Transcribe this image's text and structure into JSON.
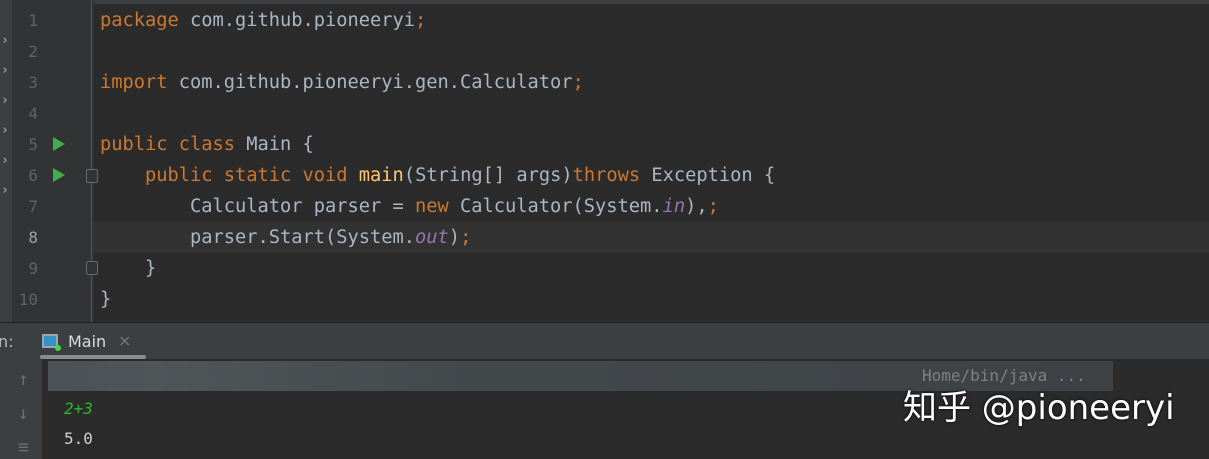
{
  "editor": {
    "line_numbers": [
      "1",
      "2",
      "3",
      "4",
      "5",
      "6",
      "7",
      "8",
      "9",
      "10"
    ],
    "current_line": "8",
    "lines": [
      [
        [
          "kw",
          "package "
        ],
        [
          "",
          "com.github.pioneeryi"
        ],
        [
          "kw",
          ";"
        ]
      ],
      [],
      [
        [
          "kw",
          "import "
        ],
        [
          "",
          "com.github.pioneeryi.gen.Calculator"
        ],
        [
          "kw",
          ";"
        ]
      ],
      [],
      [
        [
          "kw",
          "public class "
        ],
        [
          "",
          "Main {"
        ]
      ],
      [
        [
          "",
          "    "
        ],
        [
          "kw",
          "public static void "
        ],
        [
          "fn",
          "main"
        ],
        [
          "",
          "(String[] args)"
        ],
        [
          "kw",
          "throws "
        ],
        [
          "",
          "Exception {"
        ]
      ],
      [
        [
          "",
          "        Calculator parser = "
        ],
        [
          "kw",
          "new "
        ],
        [
          "",
          "Calculator(System."
        ],
        [
          "st",
          "in"
        ],
        [
          "",
          "),"
        ],
        [
          "kw",
          ";"
        ]
      ],
      [
        [
          "",
          "        parser.Start(System."
        ],
        [
          "st",
          "out"
        ],
        [
          "",
          ")"
        ],
        [
          "kw",
          ";"
        ]
      ],
      [
        [
          "",
          "    }"
        ]
      ],
      [
        [
          "",
          "}"
        ]
      ]
    ]
  },
  "run_panel": {
    "label": "n:",
    "tab_label": "Main",
    "close": "×",
    "command_tail": "Home/bin/java ...",
    "input_echo": "2+3",
    "output": "5.0"
  },
  "watermark": "知乎 @pioneeryi",
  "colors": {
    "keyword": "#cc7832",
    "method": "#ffc66d",
    "static_field": "#9876aa",
    "text": "#a9b7c6",
    "input": "#2fb52f"
  }
}
